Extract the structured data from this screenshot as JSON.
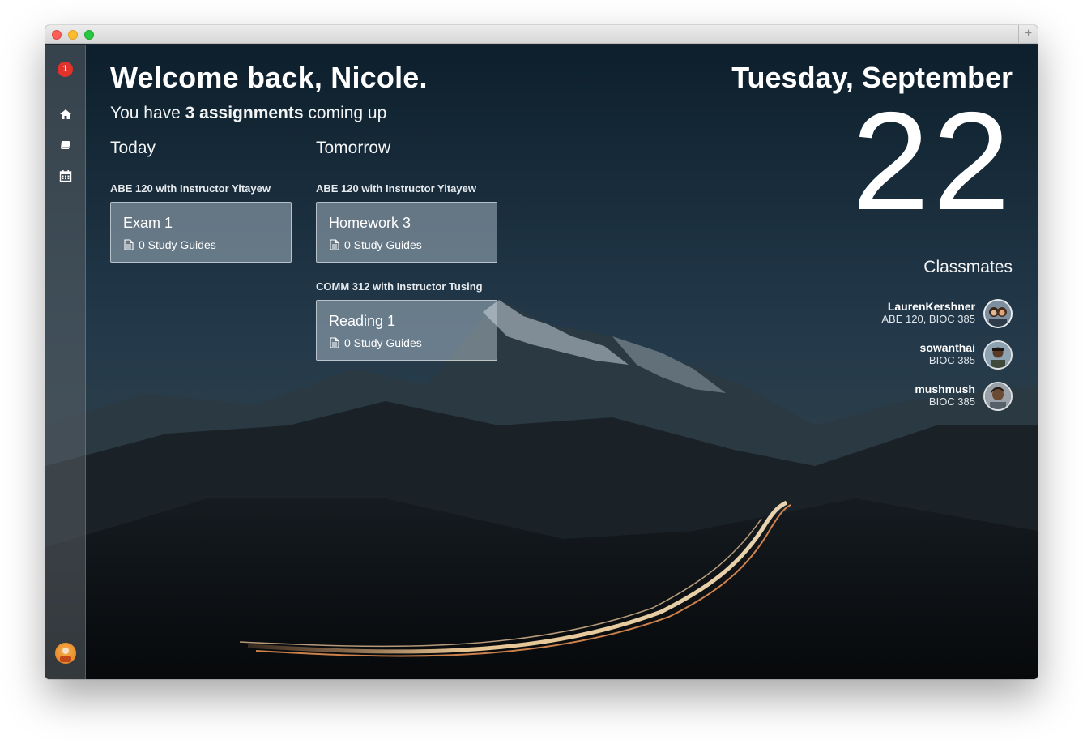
{
  "sidebar": {
    "notification_count": "1",
    "items": [
      {
        "icon": "home-icon"
      },
      {
        "icon": "book-icon"
      },
      {
        "icon": "calendar-icon"
      }
    ],
    "user_avatar_icon": "user-avatar-icon"
  },
  "header": {
    "welcome": "Welcome back, Nicole.",
    "sub_prefix": "You have ",
    "sub_bold": "3 assignments",
    "sub_suffix": " coming up"
  },
  "columns": [
    {
      "heading": "Today",
      "groups": [
        {
          "course": "ABE 120 with Instructor Yitayew",
          "assignments": [
            {
              "title": "Exam 1",
              "study_guides": "0 Study Guides"
            }
          ]
        }
      ]
    },
    {
      "heading": "Tomorrow",
      "groups": [
        {
          "course": "ABE 120 with Instructor Yitayew",
          "assignments": [
            {
              "title": "Homework 3",
              "study_guides": "0 Study Guides"
            }
          ]
        },
        {
          "course": "COMM 312 with Instructor Tusing",
          "assignments": [
            {
              "title": "Reading 1",
              "study_guides": "0 Study Guides"
            }
          ]
        }
      ]
    }
  ],
  "date": {
    "weekday_month": "Tuesday, September",
    "day": "22"
  },
  "classmates": {
    "heading": "Classmates",
    "list": [
      {
        "name": "LaurenKershner",
        "courses": "ABE 120, BIOC 385"
      },
      {
        "name": "sowanthai",
        "courses": "BIOC 385"
      },
      {
        "name": "mushmush",
        "courses": "BIOC 385"
      }
    ]
  },
  "colors": {
    "notification": "#e3322b",
    "card_bg": "rgba(205,220,230,0.42)",
    "text": "#ffffff"
  }
}
